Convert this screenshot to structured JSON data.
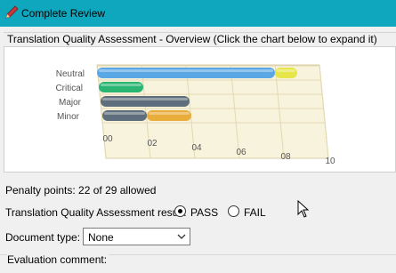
{
  "window": {
    "title": "Complete Review",
    "title_icon": "pencil-icon"
  },
  "overview": {
    "caption": "Translation Quality Assessment - Overview (Click the chart below to expand it)"
  },
  "chart_data": {
    "type": "bar",
    "orientation": "horizontal",
    "stacked": true,
    "categories": [
      "Neutral",
      "Critical",
      "Major",
      "Minor"
    ],
    "series": [
      {
        "values": [
          8,
          0,
          0,
          0
        ],
        "color": "#5aa7e6"
      },
      {
        "values": [
          1,
          0,
          0,
          0
        ],
        "color": "#e6e64a"
      },
      {
        "values": [
          0,
          2,
          0,
          0
        ],
        "color": "#2bb573"
      },
      {
        "values": [
          0,
          0,
          4,
          2
        ],
        "color": "#5e6e7c"
      },
      {
        "values": [
          0,
          0,
          0,
          2
        ],
        "color": "#e8ad3a"
      }
    ],
    "x_ticks": [
      "00",
      "02",
      "04",
      "06",
      "08",
      "10"
    ],
    "xlim": [
      0,
      10
    ],
    "grid": true
  },
  "penalty": {
    "text": "Penalty points: 22 of 29 allowed"
  },
  "result": {
    "label": "Translation Quality Assessment result:",
    "options": [
      "PASS",
      "FAIL"
    ],
    "selected": "PASS"
  },
  "document_type": {
    "label": "Document type:",
    "value": "None"
  },
  "evaluation": {
    "label": "Evaluation comment:"
  }
}
